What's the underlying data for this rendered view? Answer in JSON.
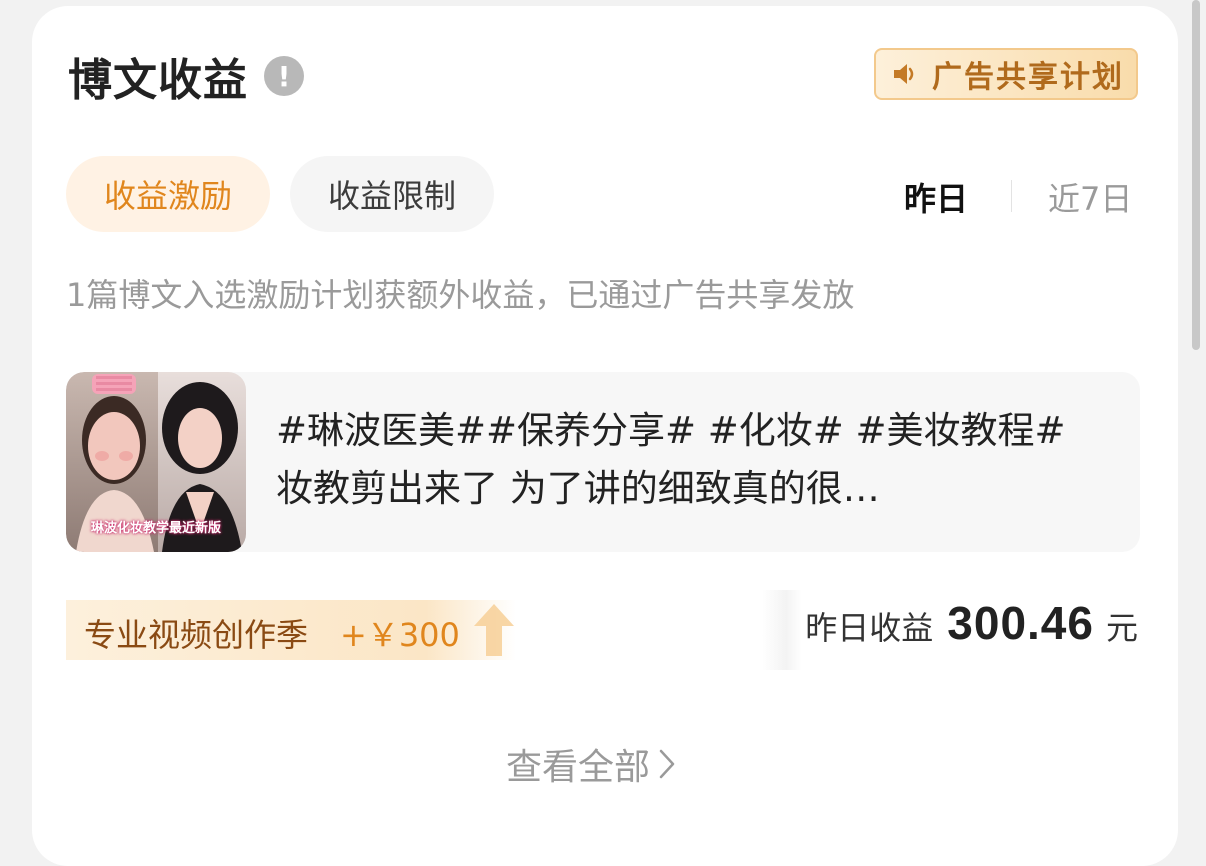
{
  "header": {
    "title": "博文收益",
    "info_icon": "info-icon",
    "ad_plan_label": "广告共享计划",
    "ad_plan_icon": "speaker-icon"
  },
  "tabs": [
    {
      "label": "收益激励",
      "active": true
    },
    {
      "label": "收益限制",
      "active": false
    }
  ],
  "period": {
    "yesterday": "昨日",
    "last7": "近7日",
    "selected": "昨日"
  },
  "description": "1篇博文入选激励计划获额外收益，已通过广告共享发放",
  "post": {
    "thumbnail_caption": "琳波化妆教学最近新版",
    "text": "#琳波医美##保养分享# #化妆# #美妆教程# 妆教剪出来了 为了讲的细致真的很…"
  },
  "reward": {
    "label": "专业视频创作季",
    "amount": "+￥300",
    "icon": "up-arrow-icon"
  },
  "earnings": {
    "label": "昨日收益",
    "value": "300.46",
    "unit": "元"
  },
  "view_all": {
    "label": "查看全部",
    "icon": "chevron-right-icon"
  },
  "colors": {
    "accent": "#e0861d",
    "active_tab_bg": "#fff2e4",
    "muted_text": "#9a9a9a",
    "card_bg": "#ffffff",
    "page_bg": "#f2f2f2"
  }
}
